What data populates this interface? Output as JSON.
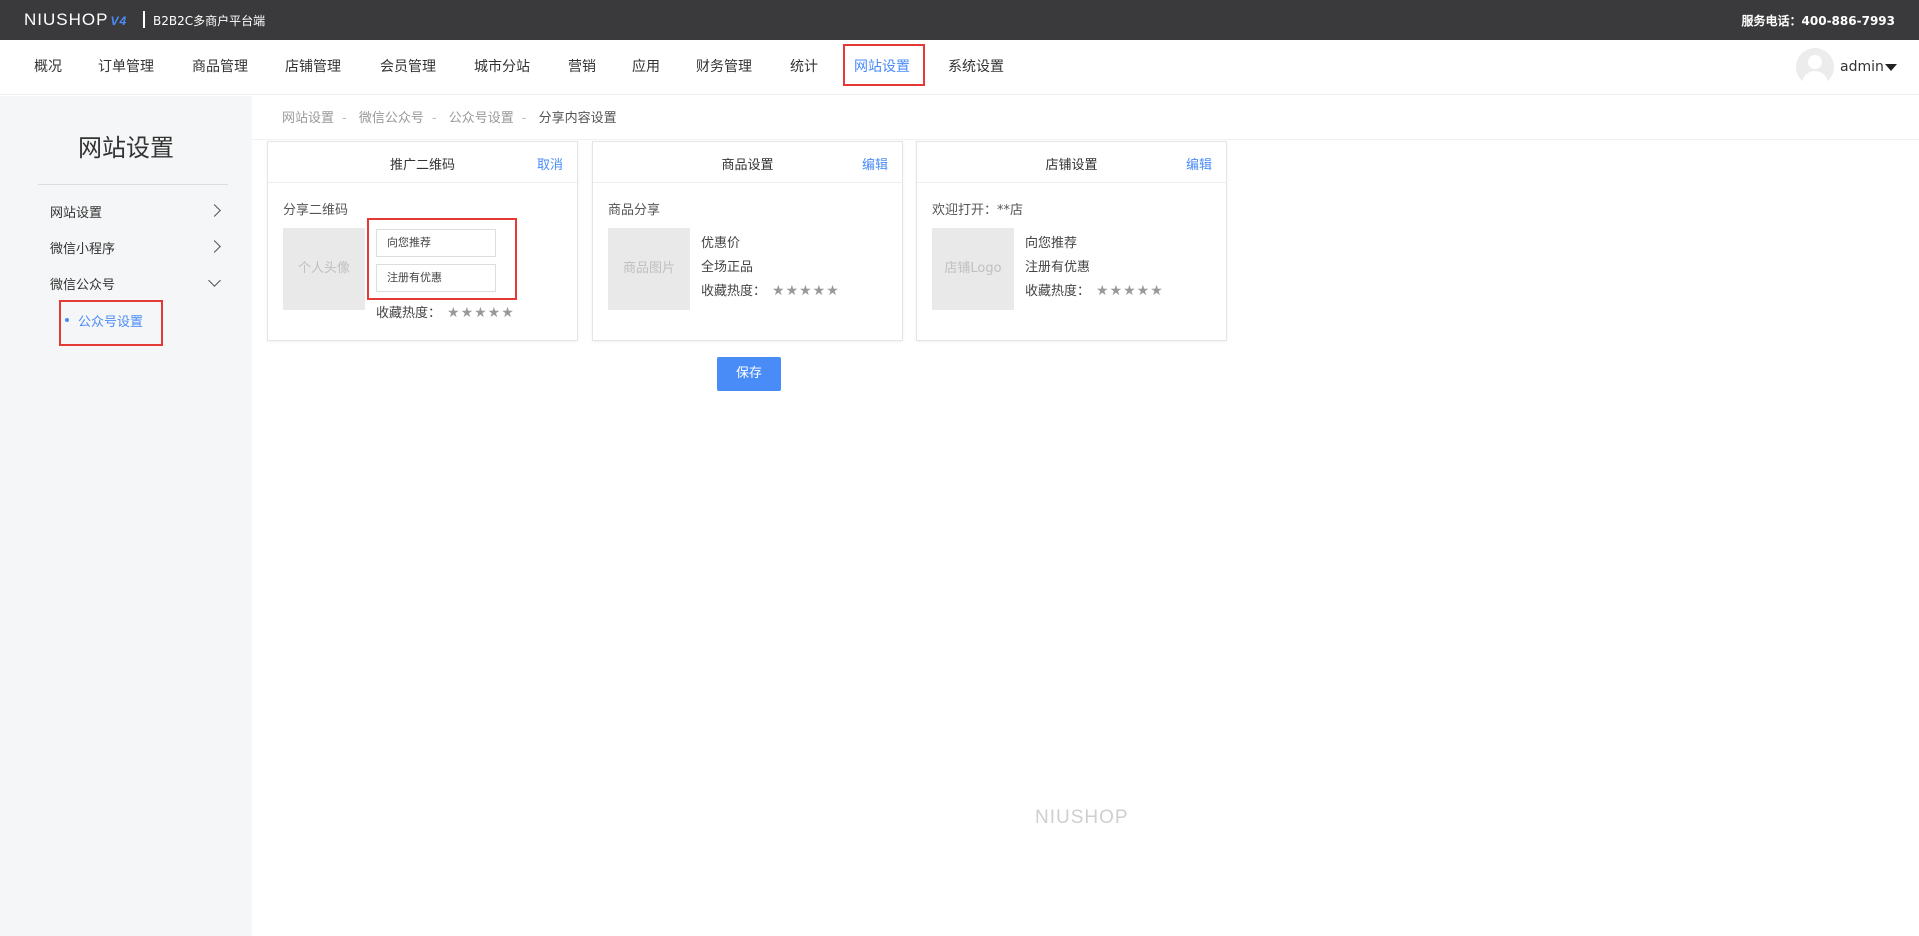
{
  "topbar": {
    "logo": "NIUSHOP",
    "logo_version": "V4",
    "subtitle": "B2B2C多商户平台端",
    "phone": "服务电话：400-886-7993"
  },
  "nav": {
    "items": [
      "概况",
      "订单管理",
      "商品管理",
      "店铺管理",
      "会员管理",
      "城市分站",
      "营销",
      "应用",
      "财务管理",
      "统计",
      "网站设置",
      "系统设置"
    ],
    "active": "网站设置",
    "user": "admin"
  },
  "sidebar": {
    "title": "网站设置",
    "items": [
      "网站设置",
      "微信小程序",
      "微信公众号"
    ],
    "sub_item": "公众号设置"
  },
  "breadcrumb": [
    "网站设置",
    "微信公众号",
    "公众号设置",
    "分享内容设置"
  ],
  "breadcrumb_sep": "-",
  "cards": [
    {
      "title": "推广二维码",
      "action": "取消",
      "label": "分享二维码",
      "placeholder": "个人头像",
      "inputs": [
        "向您推荐",
        "注册有优惠"
      ],
      "rating_label": "收藏热度：",
      "stars": "★★★★★"
    },
    {
      "title": "商品设置",
      "action": "编辑",
      "label": "商品分享",
      "placeholder": "商品图片",
      "lines": [
        "优惠价",
        "全场正品"
      ],
      "rating_label": "收藏热度：",
      "stars": "★★★★★"
    },
    {
      "title": "店铺设置",
      "action": "编辑",
      "label": "欢迎打开：**店",
      "placeholder": "店铺Logo",
      "lines": [
        "向您推荐",
        "注册有优惠"
      ],
      "rating_label": "收藏热度：",
      "stars": "★★★★★"
    }
  ],
  "save_label": "保存",
  "footer_logo": "NIUSHOP",
  "colors": {
    "accent": "#4a8cf7",
    "highlight": "#e53935",
    "topbar": "#3a3a3c"
  }
}
